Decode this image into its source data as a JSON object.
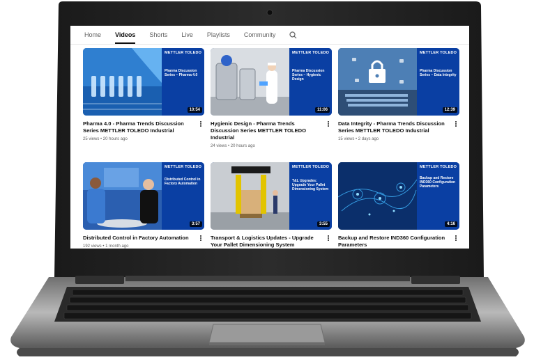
{
  "tabs": [
    {
      "label": "Home",
      "active": false
    },
    {
      "label": "Videos",
      "active": true
    },
    {
      "label": "Shorts",
      "active": false
    },
    {
      "label": "Live",
      "active": false
    },
    {
      "label": "Playlists",
      "active": false
    },
    {
      "label": "Community",
      "active": false
    }
  ],
  "search_icon": "search-icon",
  "brand_text": "METTLER TOLEDO",
  "accent_color": "#0a3fa3",
  "videos": [
    {
      "title": "Pharma 4.0 - Pharma Trends Discussion Series METTLER TOLEDO Industrial",
      "duration": "10:54",
      "meta": "25 views • 20 hours ago",
      "thumb_subtitle": "Pharma Discussion Series – Pharma 4.0"
    },
    {
      "title": "Hygienic Design - Pharma Trends Discussion Series METTLER TOLEDO Industrial",
      "duration": "11:06",
      "meta": "24 views • 20 hours ago",
      "thumb_subtitle": "Pharma Discussion Series – Hygienic Design"
    },
    {
      "title": "Data Integrity - Pharma Trends Discussion Series METTLER TOLEDO Industrial",
      "duration": "12:39",
      "meta": "15 views • 2 days ago",
      "thumb_subtitle": "Pharma Discussion Series – Data Integrity"
    },
    {
      "title": "Distributed Control in Factory Automation",
      "duration": "3:57",
      "meta": "192 views • 1 month ago",
      "thumb_subtitle": "Distributed Control in Factory Automation"
    },
    {
      "title": "Transport & Logistics Updates - Upgrade Your Pallet Dimensioning System",
      "duration": "3:55",
      "meta": "",
      "thumb_subtitle": "T&L Upgrades: Upgrade Your Pallet Dimensioning System"
    },
    {
      "title": "Backup and Restore IND360 Configuration Parameters",
      "duration": "4:16",
      "meta": "",
      "thumb_subtitle": "Backup and Restore IND360 Configuration Parameters"
    }
  ]
}
